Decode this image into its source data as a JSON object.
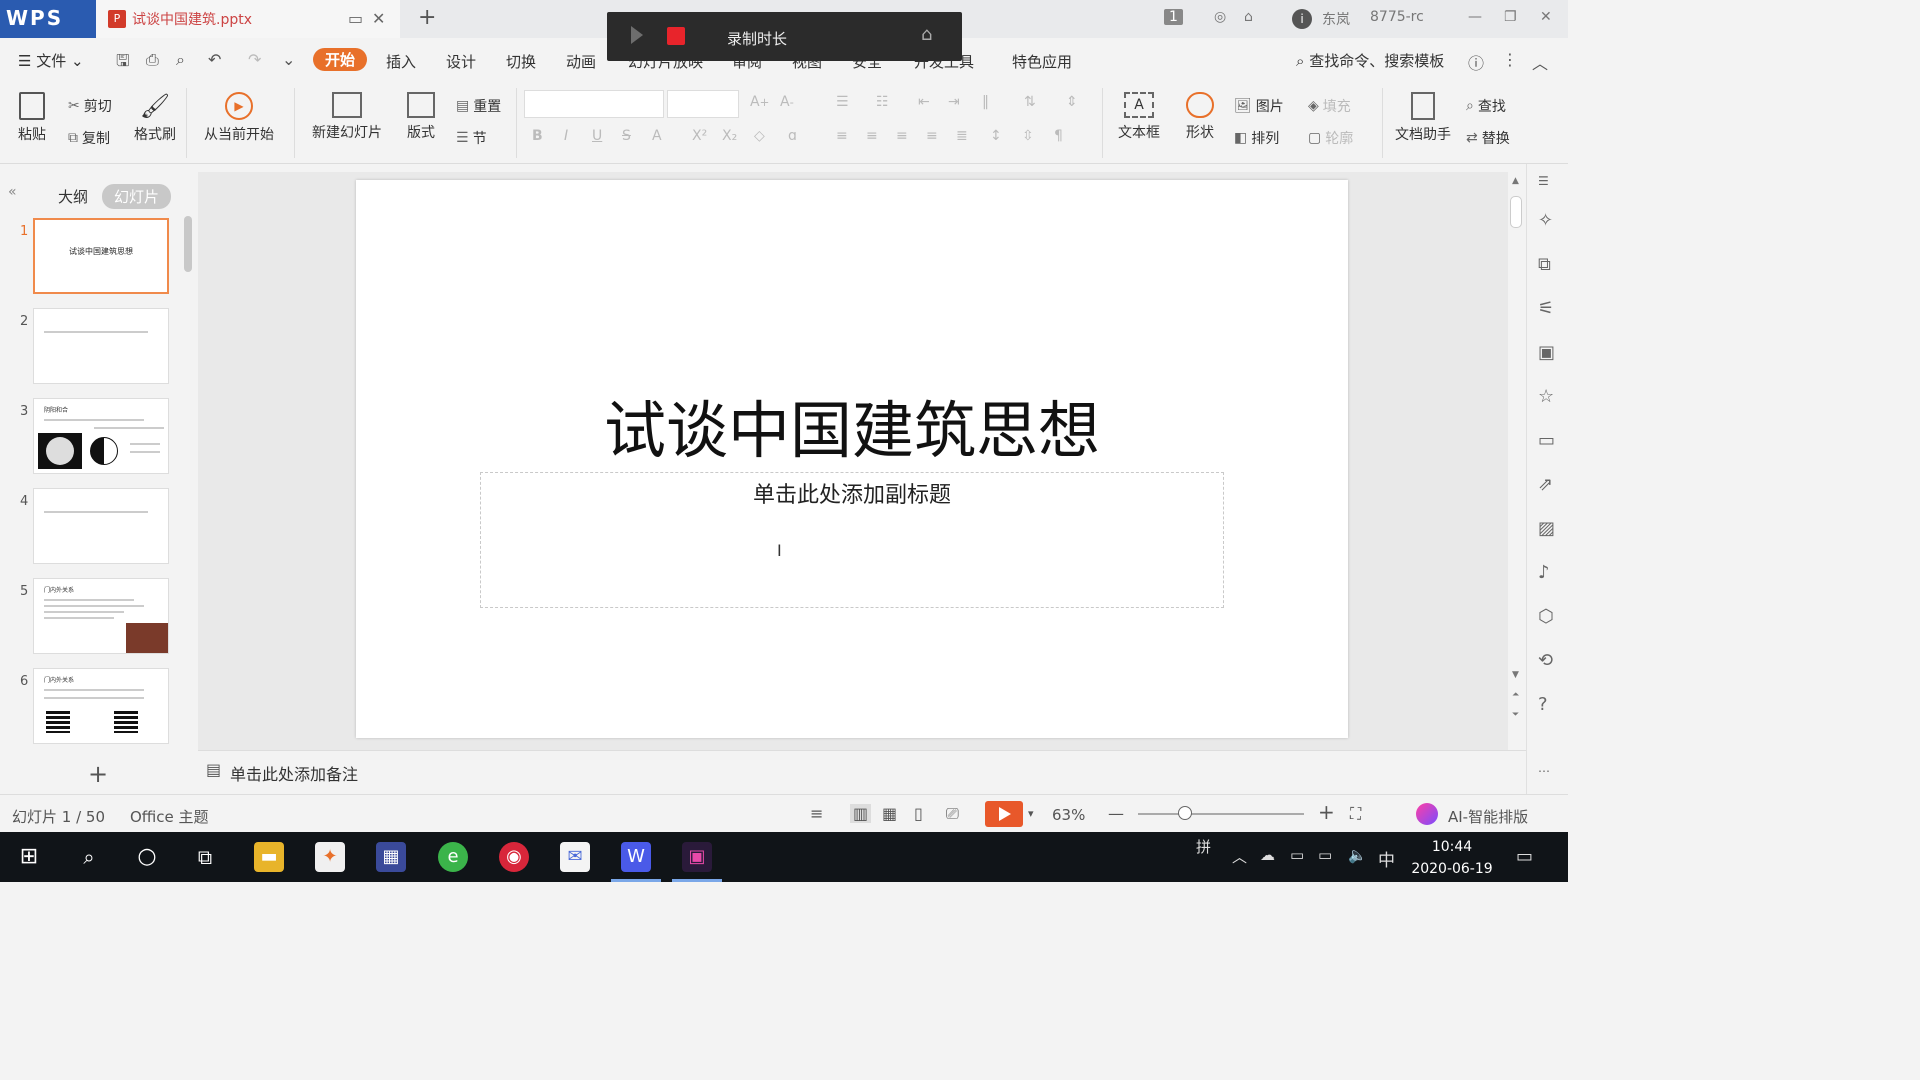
{
  "titlebar": {
    "app_logo": "WPS",
    "doc_tab_name": "试谈中国建筑.pptx",
    "new_tab": "+",
    "user_name": "东岚",
    "user_id": "8775-rc",
    "badge_num": "1"
  },
  "recorder": {
    "label": "录制时长"
  },
  "menu": {
    "file_label": "文件",
    "tabs": [
      "开始",
      "插入",
      "设计",
      "切换",
      "动画",
      "幻灯片放映",
      "审阅",
      "视图",
      "安全",
      "开发工具",
      "特色应用"
    ],
    "active_tab": "开始",
    "search_label": "查找命令、搜索模板"
  },
  "ribbon": {
    "paste": "粘贴",
    "cut": "剪切",
    "copy": "复制",
    "format_painter": "格式刷",
    "from_current": "从当前开始",
    "new_slide": "新建幻灯片",
    "layout": "版式",
    "reset": "重置",
    "section": "节",
    "textbox": "文本框",
    "shape": "形状",
    "picture": "图片",
    "fill": "填充",
    "arrange": "排列",
    "outline": "轮廓",
    "doc_assistant": "文档助手",
    "find": "查找",
    "replace": "替换"
  },
  "left_panel": {
    "tab_outline": "大纲",
    "tab_slides": "幻灯片",
    "active_tab": "幻灯片",
    "thumbnails": [
      {
        "num": "1",
        "title": "试谈中国建筑思想"
      },
      {
        "num": "2",
        "title": ""
      },
      {
        "num": "3",
        "title": "阴阳和合"
      },
      {
        "num": "4",
        "title": ""
      },
      {
        "num": "5",
        "title": "门内外关系"
      },
      {
        "num": "6",
        "title": "门内外关系"
      }
    ]
  },
  "slide": {
    "title": "试谈中国建筑思想",
    "subtitle_placeholder": "单击此处添加副标题"
  },
  "notes": {
    "placeholder": "单击此处添加备注"
  },
  "status": {
    "slide_counter": "幻灯片 1 / 50",
    "theme": "Office 主题",
    "zoom": "63%",
    "ai_layout": "AI-智能排版"
  },
  "taskbar": {
    "ime_mode": "拼",
    "lang": "中",
    "time": "10:44",
    "date": "2020-06-19"
  },
  "colors": {
    "accent_orange": "#e8702a",
    "record_red": "#e8242b",
    "wps_blue": "#2a5bb0"
  }
}
